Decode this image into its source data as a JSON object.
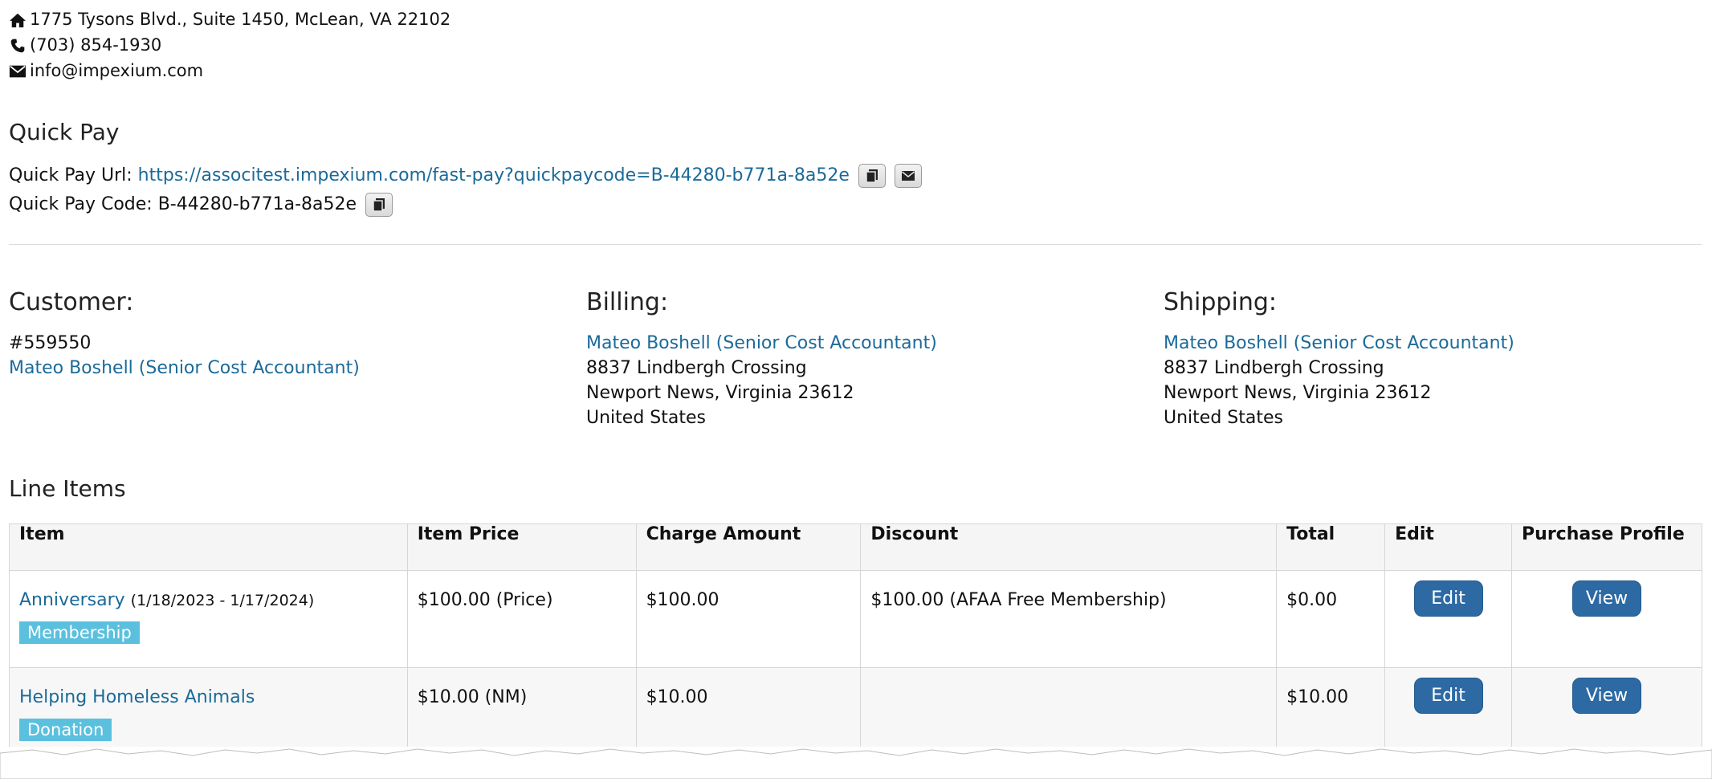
{
  "contact": {
    "address": "1775 Tysons Blvd., Suite 1450, McLean, VA 22102",
    "phone": "(703) 854-1930",
    "email": "info@impexium.com"
  },
  "quick_pay": {
    "title": "Quick Pay",
    "url_label": "Quick Pay Url:",
    "url": "https://associtest.impexium.com/fast-pay?quickpaycode=B-44280-b771a-8a52e",
    "code_label": "Quick Pay Code:",
    "code": "B-44280-b771a-8a52e"
  },
  "customer": {
    "title": "Customer:",
    "id": "#559550",
    "name": "Mateo Boshell (Senior Cost Accountant)"
  },
  "billing": {
    "title": "Billing:",
    "name": "Mateo Boshell (Senior Cost Accountant)",
    "street": "8837 Lindbergh Crossing",
    "city": "Newport News, Virginia 23612",
    "country": "United States"
  },
  "shipping": {
    "title": "Shipping:",
    "name": "Mateo Boshell (Senior Cost Accountant)",
    "street": "8837 Lindbergh Crossing",
    "city": "Newport News, Virginia 23612",
    "country": "United States"
  },
  "line_items": {
    "title": "Line Items",
    "headers": [
      "Item",
      "Item Price",
      "Charge Amount",
      "Discount",
      "Total",
      "Edit",
      "Purchase Profile"
    ],
    "rows": [
      {
        "item": "Anniversary",
        "dates": "(1/18/2023 - 1/17/2024)",
        "badge": "Membership",
        "item_price": "$100.00 (Price)",
        "charge_amount": "$100.00",
        "discount": "$100.00 (AFAA Free Membership)",
        "total": "$0.00",
        "edit_label": "Edit",
        "view_label": "View"
      },
      {
        "item": "Helping Homeless Animals",
        "dates": "",
        "badge": "Donation",
        "item_price": "$10.00 (NM)",
        "charge_amount": "$10.00",
        "discount": "",
        "total": "$10.00",
        "edit_label": "Edit",
        "view_label": "View"
      }
    ]
  }
}
